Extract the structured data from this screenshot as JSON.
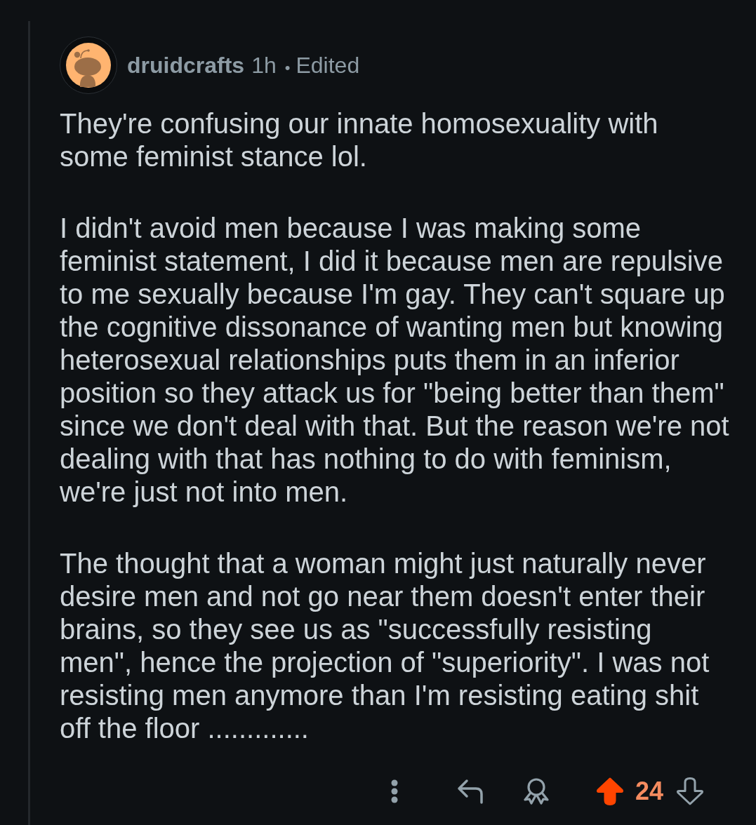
{
  "comment": {
    "author": "druidcrafts",
    "age": "1h",
    "separator": "•",
    "edited": "Edited",
    "body": [
      "They're confusing our innate homosexuality with some feminist stance lol.",
      "I didn't avoid men because I was making some feminist statement, I did it because men are repulsive to me sexually because I'm gay. They can't square up the cognitive dissonance of wanting men but knowing heterosexual relationships puts them in an inferior position so they attack us for \"being better than them\" since we don't deal with that. But the reason we're not dealing with that has nothing to do with feminism, we're just not into men.",
      "The thought that a woman might just naturally never desire men and not go near them doesn't enter their brains, so they see us as \"successfully resisting men\", hence the projection of \"superiority\". I was not resisting men anymore than I'm resisting eating shit off the floor ............."
    ],
    "upvoted": true,
    "downvoted": false,
    "score": "24"
  }
}
